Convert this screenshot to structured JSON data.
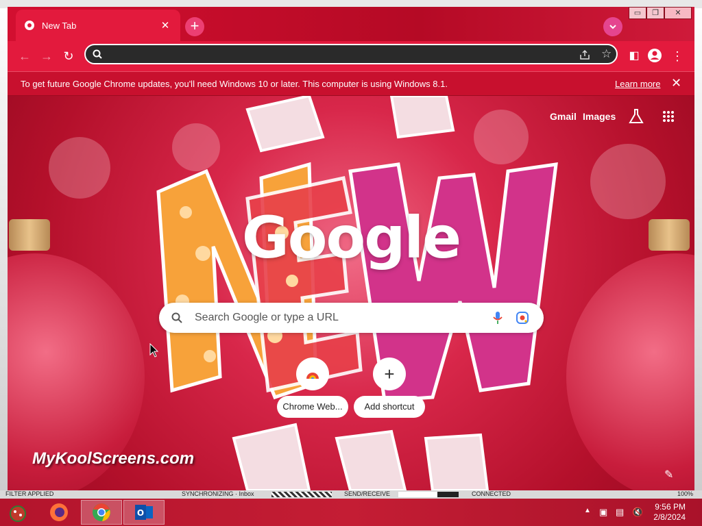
{
  "browser": {
    "tab": {
      "title": "New Tab",
      "close": "✕"
    },
    "new_tab_symbol": "+",
    "window_buttons": [
      "▭",
      "❐",
      "✕"
    ],
    "infobar": {
      "message": "To get future Google Chrome updates, you'll need Windows 10 or later. This computer is using Windows 8.1.",
      "link": "Learn more",
      "close": "✕"
    }
  },
  "ntp": {
    "top_links": {
      "gmail": "Gmail",
      "images": "Images"
    },
    "logo": "Google",
    "search_placeholder": "Search Google or type a URL",
    "shortcuts": [
      {
        "label": "Chrome Web...",
        "icon": "chrome-web-store-icon"
      },
      {
        "label": "Add shortcut",
        "icon": "plus-icon",
        "symbol": "+"
      }
    ],
    "watermark": "MyKoolScreens.com"
  },
  "outlook_status": {
    "filter": "FILTER APPLIED",
    "sync": "SYNCHRONIZING · Inbox",
    "send": "SEND/RECEIVE",
    "connected": "CONNECTED",
    "zoom": "100%"
  },
  "taskbar": {
    "time": "9:56 PM",
    "date": "2/8/2024"
  }
}
